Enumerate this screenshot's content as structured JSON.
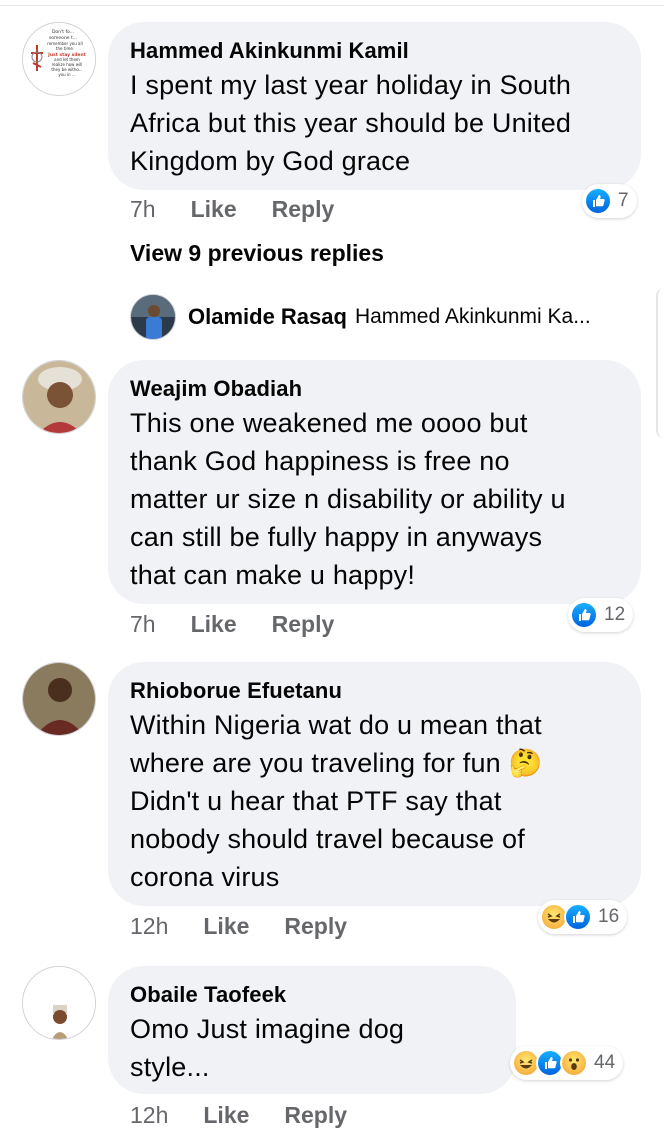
{
  "comments": [
    {
      "author": "Hammed Akinkunmi Kamil",
      "text_lines": [
        "I spent my last year holiday in South",
        "Africa but this year should be United",
        "Kingdom by God grace"
      ],
      "time": "7h",
      "like_label": "Like",
      "reply_label": "Reply",
      "reaction_count": "7",
      "avatar_lines": [
        "Don't fo...",
        "someone t...",
        "remember you all",
        "the time.",
        "Just stay silent",
        "and let them",
        "realize how will",
        "they be witho...",
        "you in ..."
      ]
    },
    {
      "author": "Weajim Obadiah",
      "text_lines": [
        "This one weakened me oooo but",
        "thank God happiness is free no",
        "matter ur size n disability or ability u",
        "can still be fully happy in anyways",
        "that can make u happy!"
      ],
      "time": "7h",
      "like_label": "Like",
      "reply_label": "Reply",
      "reaction_count": "12"
    },
    {
      "author": "Rhioborue Efuetanu",
      "text_lines": [
        "Within Nigeria wat do u mean that",
        "where are you traveling for fun 🤔",
        "Didn't u hear that  PTF say that",
        "nobody should travel because of",
        "corona virus"
      ],
      "time": "12h",
      "like_label": "Like",
      "reply_label": "Reply",
      "reaction_count": "16"
    },
    {
      "author": "Obaile Taofeek",
      "text_lines": [
        "Omo Just imagine dog",
        "style..."
      ],
      "time": "12h",
      "like_label": "Like",
      "reply_label": "Reply",
      "reaction_count": "44"
    }
  ],
  "view_previous": "View 9 previous replies",
  "reply_preview": {
    "author": "Olamide Rasaq",
    "snippet": "Hammed Akinkunmi Ka..."
  },
  "colors": {
    "bubble": "#f0f2f5",
    "like_blue": "#1877f2",
    "meta_gray": "#65676b"
  }
}
